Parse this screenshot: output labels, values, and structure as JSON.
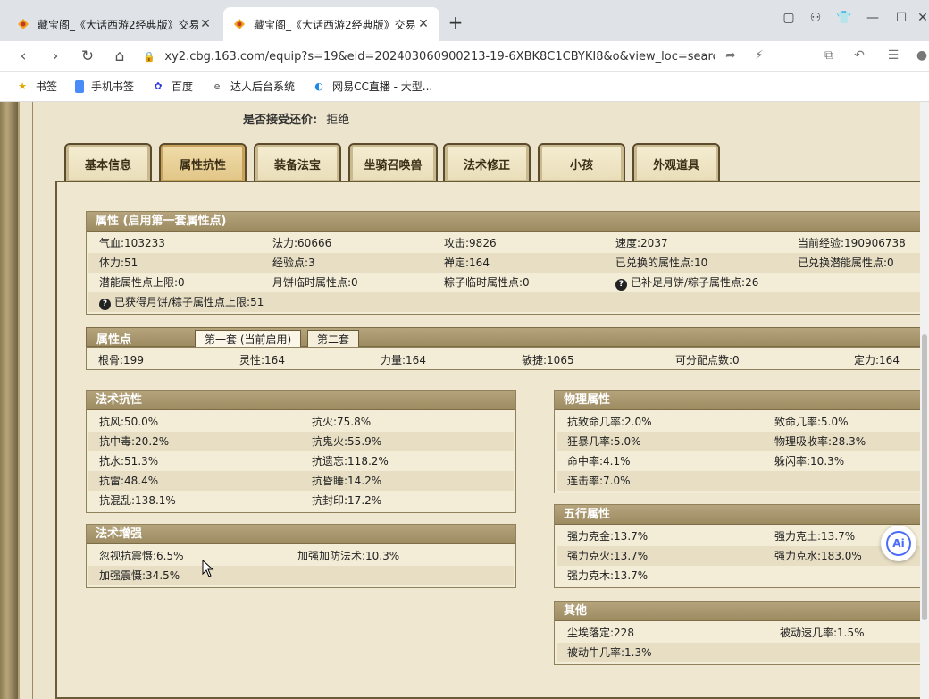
{
  "browser": {
    "tabs": [
      {
        "title": "藏宝阁_《大话西游2经典版》交易"
      },
      {
        "title": "藏宝阁_《大话西游2经典版》交易"
      }
    ],
    "new_tab": "+",
    "url": "xy2.cbg.163.com/equip?s=19&eid=202403060900213-19-6XBK8C1CBYKI8&o&view_loc=search_cond|...",
    "bookmarks": [
      "书签",
      "手机书签",
      "百度",
      "达人后台系统",
      "网易CC直播 - 大型..."
    ]
  },
  "page": {
    "offer_label": "是否接受还价:",
    "offer_value": "拒绝",
    "tabs": [
      "基本信息",
      "属性抗性",
      "装备法宝",
      "坐骑召唤兽",
      "法术修正",
      "小孩",
      "外观道具"
    ],
    "attr": {
      "title": "属性 (启用第一套属性点)",
      "rows": [
        [
          "气血:103233",
          "法力:60666",
          "攻击:9826",
          "速度:2037",
          "当前经验:190906738"
        ],
        [
          "体力:51",
          "经验点:3",
          "禅定:164",
          "已兑换的属性点:10",
          "已兑换潜能属性点:0"
        ],
        [
          "潜能属性点上限:0",
          "月饼临时属性点:0",
          "粽子临时属性点:0",
          "已补足月饼/粽子属性点:26"
        ],
        [
          "已获得月饼/粽子属性点上限:51"
        ]
      ]
    },
    "points": {
      "title": "属性点",
      "subtabs": [
        "第一套 (当前启用)",
        "第二套"
      ],
      "values": [
        "根骨:199",
        "灵性:164",
        "力量:164",
        "敏捷:1065",
        "可分配点数:0",
        "定力:164"
      ]
    },
    "spell_resist": {
      "title": "法术抗性",
      "rows": [
        [
          "抗风:50.0%",
          "抗火:75.8%"
        ],
        [
          "抗中毒:20.2%",
          "抗鬼火:55.9%"
        ],
        [
          "抗水:51.3%",
          "抗遗忘:118.2%"
        ],
        [
          "抗雷:48.4%",
          "抗昏睡:14.2%"
        ],
        [
          "抗混乱:138.1%",
          "抗封印:17.2%"
        ]
      ]
    },
    "spell_enhance": {
      "title": "法术增强",
      "rows": [
        [
          "忽视抗震慑:6.5%",
          "加强加防法术:10.3%"
        ],
        [
          "加强震慑:34.5%",
          ""
        ]
      ]
    },
    "physical": {
      "title": "物理属性",
      "rows": [
        [
          "抗致命几率:2.0%",
          "致命几率:5.0%"
        ],
        [
          "狂暴几率:5.0%",
          "物理吸收率:28.3%"
        ],
        [
          "命中率:4.1%",
          "躲闪率:10.3%"
        ],
        [
          "连击率:7.0%",
          ""
        ]
      ]
    },
    "five": {
      "title": "五行属性",
      "rows": [
        [
          "强力克金:13.7%",
          "强力克土:13.7%"
        ],
        [
          "强力克火:13.7%",
          "强力克水:183.0%"
        ],
        [
          "强力克木:13.7%",
          ""
        ]
      ]
    },
    "other": {
      "title": "其他",
      "rows": [
        [
          "尘埃落定:228",
          "被动速几率:1.5%"
        ],
        [
          "被动牛几率:1.3%",
          ""
        ]
      ]
    },
    "ai_label": "Ai"
  },
  "colors": {
    "header": "#a8966c",
    "panel": "#f3ecd6",
    "border": "#6b5c38"
  }
}
